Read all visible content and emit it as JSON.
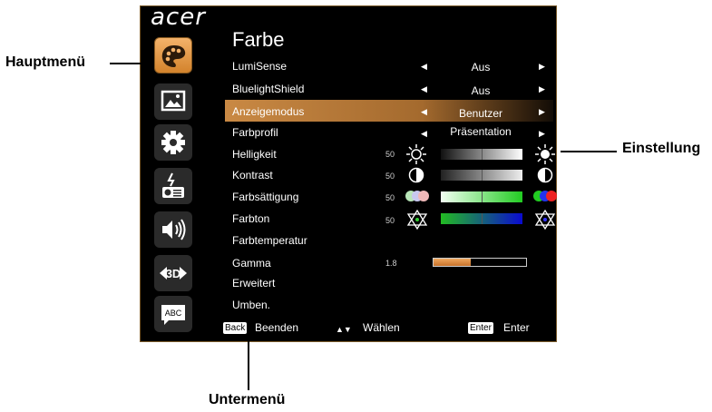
{
  "brand": "acer",
  "menu_title": "Farbe",
  "sidebar": [
    {
      "icon": "palette-icon",
      "label": ""
    },
    {
      "icon": "image-icon",
      "label": ""
    },
    {
      "icon": "gear-icon",
      "label": ""
    },
    {
      "icon": "projector-power-icon",
      "label": ""
    },
    {
      "icon": "speaker-icon",
      "label": ""
    },
    {
      "icon": "3d-icon",
      "label": "3D"
    },
    {
      "icon": "language-icon",
      "label": "ABC"
    }
  ],
  "rows": [
    {
      "label": "LumiSense",
      "value": "Aus"
    },
    {
      "label": "BluelightShield",
      "value": "Aus"
    },
    {
      "label": "Anzeigemodus",
      "value": "Benutzer"
    },
    {
      "label": "Farbprofil",
      "value": "Präsentation"
    },
    {
      "label": "Helligkeit",
      "number": "50"
    },
    {
      "label": "Kontrast",
      "number": "50"
    },
    {
      "label": "Farbsättigung",
      "number": "50"
    },
    {
      "label": "Farbton",
      "number": "50"
    },
    {
      "label": "Farbtemperatur"
    },
    {
      "label": "Gamma",
      "number": "1.8",
      "level": 0.4
    },
    {
      "label": "Erweitert"
    },
    {
      "label": "Umben."
    }
  ],
  "footer": {
    "back_key": "Back",
    "back_label": "Beenden",
    "select_label": "Wählen",
    "enter_key": "Enter",
    "enter_label": "Enter"
  },
  "callouts": {
    "main_menu": "Hauptmenü",
    "setting": "Einstellung",
    "submenu": "Untermenü"
  },
  "colors": {
    "highlight": "#c98944",
    "gamma_fill": "#e08a3a",
    "active_tab": "#e8a04e"
  }
}
